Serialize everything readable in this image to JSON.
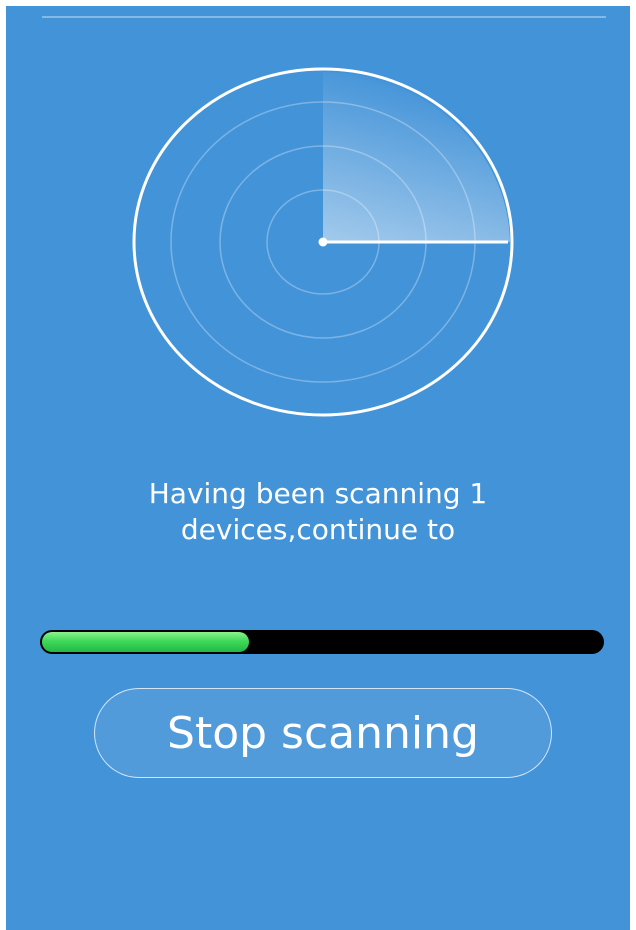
{
  "scan": {
    "status_text": "Having been scanning 1 devices,continue to",
    "progress": 0.37
  },
  "actions": {
    "stop_label": "Stop scanning"
  },
  "colors": {
    "background": "#4393d8",
    "progress_track": "#000000",
    "progress_fill": "#3fd95a",
    "text": "#ffffff"
  },
  "icons": {
    "radar": "radar-sweep-icon"
  }
}
